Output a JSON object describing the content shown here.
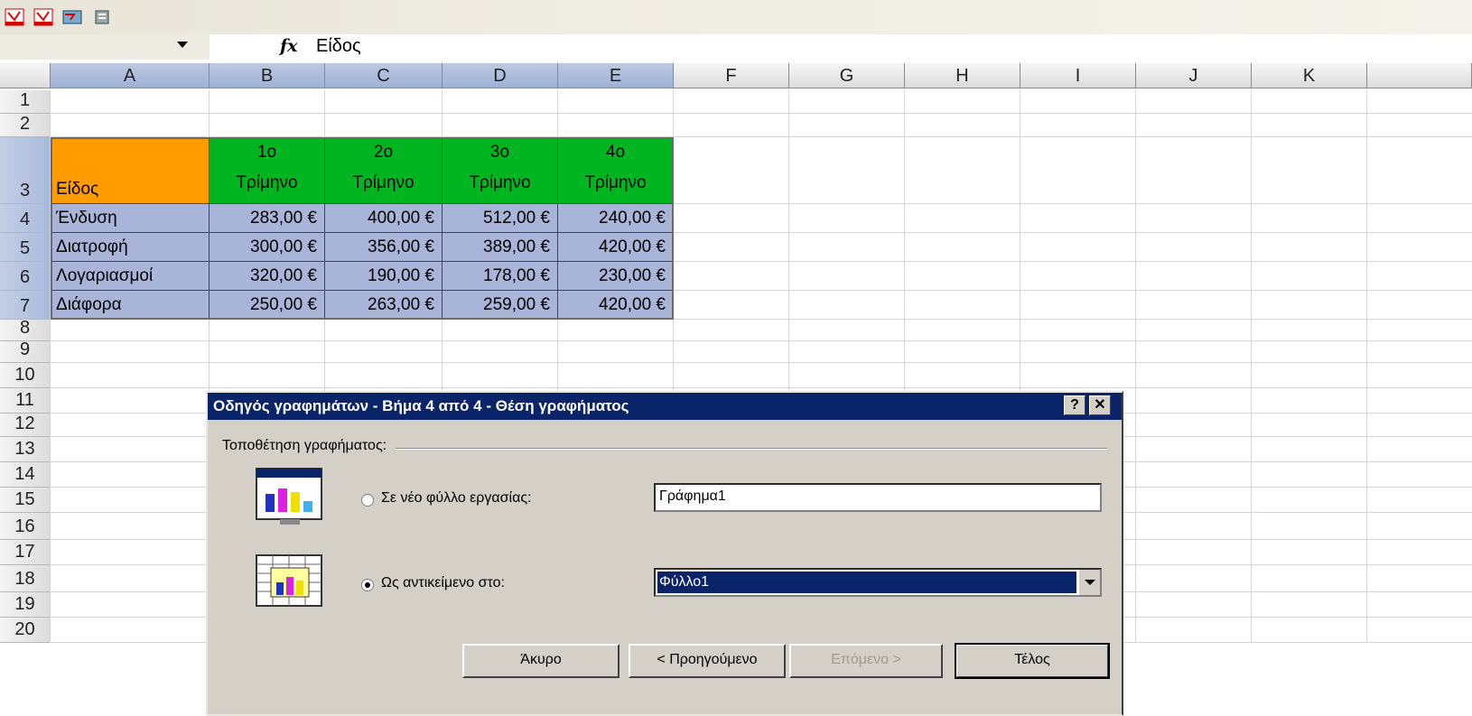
{
  "formula_bar": {
    "fx_label": "fx",
    "content": "Είδος"
  },
  "columns": [
    "A",
    "B",
    "C",
    "D",
    "E",
    "F",
    "G",
    "H",
    "I",
    "J",
    "K"
  ],
  "rows": [
    "1",
    "2",
    "3",
    "4",
    "5",
    "6",
    "7",
    "8",
    "9",
    "10",
    "11",
    "12",
    "13",
    "14",
    "15",
    "16",
    "17",
    "18",
    "19",
    "20"
  ],
  "table": {
    "corner": "Είδος",
    "quarters": [
      {
        "num": "1ο",
        "word": "Τρίμηνο"
      },
      {
        "num": "2ο",
        "word": "Τρίμηνο"
      },
      {
        "num": "3ο",
        "word": "Τρίμηνο"
      },
      {
        "num": "4ο",
        "word": "Τρίμηνο"
      }
    ],
    "rows": [
      {
        "label": "Ένδυση",
        "values": [
          "283,00 €",
          "400,00 €",
          "512,00 €",
          "240,00 €"
        ]
      },
      {
        "label": "Διατροφή",
        "values": [
          "300,00 €",
          "356,00 €",
          "389,00 €",
          "420,00 €"
        ]
      },
      {
        "label": "Λογαριασμοί",
        "values": [
          "320,00 €",
          "190,00 €",
          "178,00 €",
          "230,00 €"
        ]
      },
      {
        "label": "Διάφορα",
        "values": [
          "250,00 €",
          "263,00 €",
          "259,00 €",
          "420,00 €"
        ]
      }
    ]
  },
  "dialog": {
    "title": "Οδηγός γραφημάτων - Βήμα 4 από 4 - Θέση γραφήματος",
    "help_label": "?",
    "close_label": "✕",
    "group_label": "Τοποθέτηση γραφήματος:",
    "option_new_sheet": {
      "label": "Σε νέο φύλλο εργασίας:",
      "value": "Γράφημα1",
      "selected": false
    },
    "option_object": {
      "label": "Ως αντικείμενο στο:",
      "value": "Φύλλο1",
      "selected": true
    },
    "buttons": {
      "cancel": "Άκυρο",
      "back": "< Προηγούμενο",
      "next": "Επόμενο >",
      "finish": "Τέλος"
    }
  },
  "colors": {
    "header_green": "#00b520",
    "corner_orange": "#ff9c00",
    "selection_blue": "#a8b4d8",
    "title_bar": "#0a246a"
  }
}
